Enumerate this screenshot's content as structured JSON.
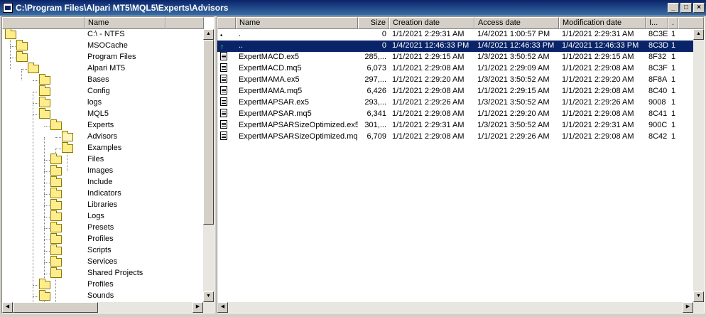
{
  "window": {
    "title": "C:\\Program Files\\Alpari MT5\\MQL5\\Experts\\Advisors",
    "minimize": "_",
    "maximize": "□",
    "close": "×"
  },
  "tree": {
    "header": "Name",
    "items": [
      {
        "label": "C:\\ - NTFS",
        "depth": 0
      },
      {
        "label": "MSOCache",
        "depth": 1
      },
      {
        "label": "Program Files",
        "depth": 1
      },
      {
        "label": "Alpari MT5",
        "depth": 2
      },
      {
        "label": "Bases",
        "depth": 3
      },
      {
        "label": "Config",
        "depth": 3
      },
      {
        "label": "logs",
        "depth": 3
      },
      {
        "label": "MQL5",
        "depth": 3
      },
      {
        "label": "Experts",
        "depth": 4
      },
      {
        "label": "Advisors",
        "depth": 5
      },
      {
        "label": "Examples",
        "depth": 5
      },
      {
        "label": "Files",
        "depth": 4
      },
      {
        "label": "Images",
        "depth": 4
      },
      {
        "label": "Include",
        "depth": 4
      },
      {
        "label": "Indicators",
        "depth": 4
      },
      {
        "label": "Libraries",
        "depth": 4
      },
      {
        "label": "Logs",
        "depth": 4
      },
      {
        "label": "Presets",
        "depth": 4
      },
      {
        "label": "Profiles",
        "depth": 4
      },
      {
        "label": "Scripts",
        "depth": 4
      },
      {
        "label": "Services",
        "depth": 4
      },
      {
        "label": "Shared Projects",
        "depth": 4
      },
      {
        "label": "Profiles",
        "depth": 3
      },
      {
        "label": "Sounds",
        "depth": 3
      }
    ]
  },
  "files": {
    "columns": [
      "Name",
      "Size",
      "Creation date",
      "Access date",
      "Modification date",
      "I...",
      "."
    ],
    "rows": [
      {
        "icon": "dot-icon",
        "name": ".",
        "size": "0",
        "created": "1/1/2021  2:29:31 AM",
        "accessed": "1/4/2021  1:00:57 PM",
        "modified": "1/1/2021  2:29:31 AM",
        "id": "8C3E",
        "flag": "1",
        "selected": false
      },
      {
        "icon": "up-arrow-icon",
        "name": "..",
        "size": "0",
        "created": "1/4/2021  12:46:33 PM",
        "accessed": "1/4/2021  12:46:33 PM",
        "modified": "1/4/2021  12:46:33 PM",
        "id": "8C3D",
        "flag": "1",
        "selected": true
      },
      {
        "icon": "file-icon",
        "name": "ExpertMACD.ex5",
        "size": "285,...",
        "created": "1/1/2021  2:29:15 AM",
        "accessed": "1/3/2021  3:50:52 AM",
        "modified": "1/1/2021  2:29:15 AM",
        "id": "8F32",
        "flag": "1",
        "selected": false
      },
      {
        "icon": "file-icon",
        "name": "ExpertMACD.mq5",
        "size": "6,073",
        "created": "1/1/2021  2:29:08 AM",
        "accessed": "1/1/2021  2:29:09 AM",
        "modified": "1/1/2021  2:29:08 AM",
        "id": "8C3F",
        "flag": "1",
        "selected": false
      },
      {
        "icon": "file-icon",
        "name": "ExpertMAMA.ex5",
        "size": "297,...",
        "created": "1/1/2021  2:29:20 AM",
        "accessed": "1/3/2021  3:50:52 AM",
        "modified": "1/1/2021  2:29:20 AM",
        "id": "8F8A",
        "flag": "1",
        "selected": false
      },
      {
        "icon": "file-icon",
        "name": "ExpertMAMA.mq5",
        "size": "6,426",
        "created": "1/1/2021  2:29:08 AM",
        "accessed": "1/1/2021  2:29:15 AM",
        "modified": "1/1/2021  2:29:08 AM",
        "id": "8C40",
        "flag": "1",
        "selected": false
      },
      {
        "icon": "file-icon",
        "name": "ExpertMAPSAR.ex5",
        "size": "293,...",
        "created": "1/1/2021  2:29:26 AM",
        "accessed": "1/3/2021  3:50:52 AM",
        "modified": "1/1/2021  2:29:26 AM",
        "id": "9008",
        "flag": "1",
        "selected": false
      },
      {
        "icon": "file-icon",
        "name": "ExpertMAPSAR.mq5",
        "size": "6,341",
        "created": "1/1/2021  2:29:08 AM",
        "accessed": "1/1/2021  2:29:20 AM",
        "modified": "1/1/2021  2:29:08 AM",
        "id": "8C41",
        "flag": "1",
        "selected": false
      },
      {
        "icon": "file-icon",
        "name": "ExpertMAPSARSizeOptimized.ex5",
        "size": "301,...",
        "created": "1/1/2021  2:29:31 AM",
        "accessed": "1/3/2021  3:50:52 AM",
        "modified": "1/1/2021  2:29:31 AM",
        "id": "900C",
        "flag": "1",
        "selected": false
      },
      {
        "icon": "file-icon",
        "name": "ExpertMAPSARSizeOptimized.mq5",
        "size": "6,709",
        "created": "1/1/2021  2:29:08 AM",
        "accessed": "1/1/2021  2:29:26 AM",
        "modified": "1/1/2021  2:29:08 AM",
        "id": "8C42",
        "flag": "1",
        "selected": false
      }
    ]
  },
  "scroll": {
    "up": "▲",
    "down": "▼",
    "left": "◀",
    "right": "▶"
  },
  "colors": {
    "selection": "#0a246a",
    "folder": "#ffec8b"
  }
}
